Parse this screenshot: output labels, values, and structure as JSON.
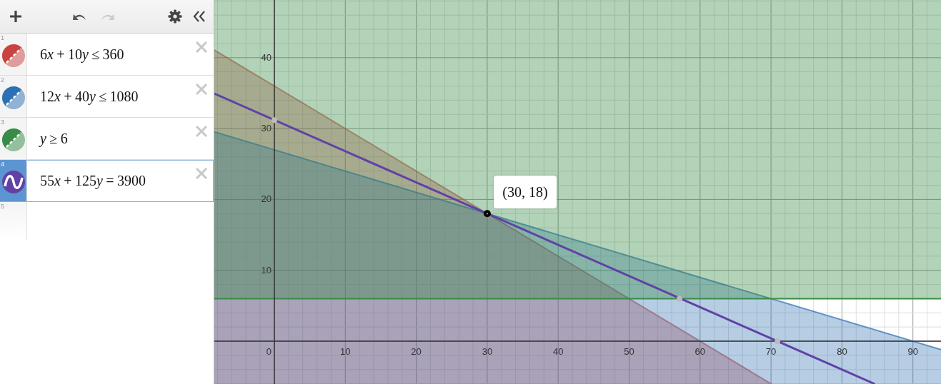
{
  "toolbar": {
    "undo": {
      "disabled": false
    },
    "redo": {
      "disabled": true
    }
  },
  "expressions": [
    {
      "index": "1",
      "tokens": [
        {
          "kind": "num",
          "text": "6"
        },
        {
          "kind": "var",
          "text": "x"
        },
        {
          "kind": "op",
          "text": "+"
        },
        {
          "kind": "num",
          "text": "10"
        },
        {
          "kind": "var",
          "text": "y"
        },
        {
          "kind": "op",
          "text": "≤"
        },
        {
          "kind": "num",
          "text": "360"
        }
      ],
      "kind": "inequality",
      "color": "#c74440",
      "selected": false
    },
    {
      "index": "2",
      "tokens": [
        {
          "kind": "num",
          "text": "12"
        },
        {
          "kind": "var",
          "text": "x"
        },
        {
          "kind": "op",
          "text": "+"
        },
        {
          "kind": "num",
          "text": "40"
        },
        {
          "kind": "var",
          "text": "y"
        },
        {
          "kind": "op",
          "text": "≤"
        },
        {
          "kind": "num",
          "text": "1080"
        }
      ],
      "kind": "inequality",
      "color": "#2d70b3",
      "selected": false
    },
    {
      "index": "3",
      "tokens": [
        {
          "kind": "var",
          "text": "y"
        },
        {
          "kind": "op",
          "text": "≥"
        },
        {
          "kind": "num",
          "text": "6"
        }
      ],
      "kind": "inequality",
      "color": "#388c46",
      "selected": false
    },
    {
      "index": "4",
      "tokens": [
        {
          "kind": "num",
          "text": "55"
        },
        {
          "kind": "var",
          "text": "x"
        },
        {
          "kind": "op",
          "text": "+"
        },
        {
          "kind": "num",
          "text": "125"
        },
        {
          "kind": "var",
          "text": "y"
        },
        {
          "kind": "op",
          "text": "="
        },
        {
          "kind": "num",
          "text": "3900"
        }
      ],
      "kind": "equation",
      "color": "#6042a6",
      "selected": true
    }
  ],
  "next_index": "5",
  "graph": {
    "x_ticks": [
      "0",
      "10",
      "20",
      "30",
      "40",
      "50",
      "60",
      "70",
      "80",
      "90"
    ],
    "y_ticks": [
      "40",
      "30",
      "20",
      "10"
    ],
    "point_label": "(30, 18)"
  }
}
